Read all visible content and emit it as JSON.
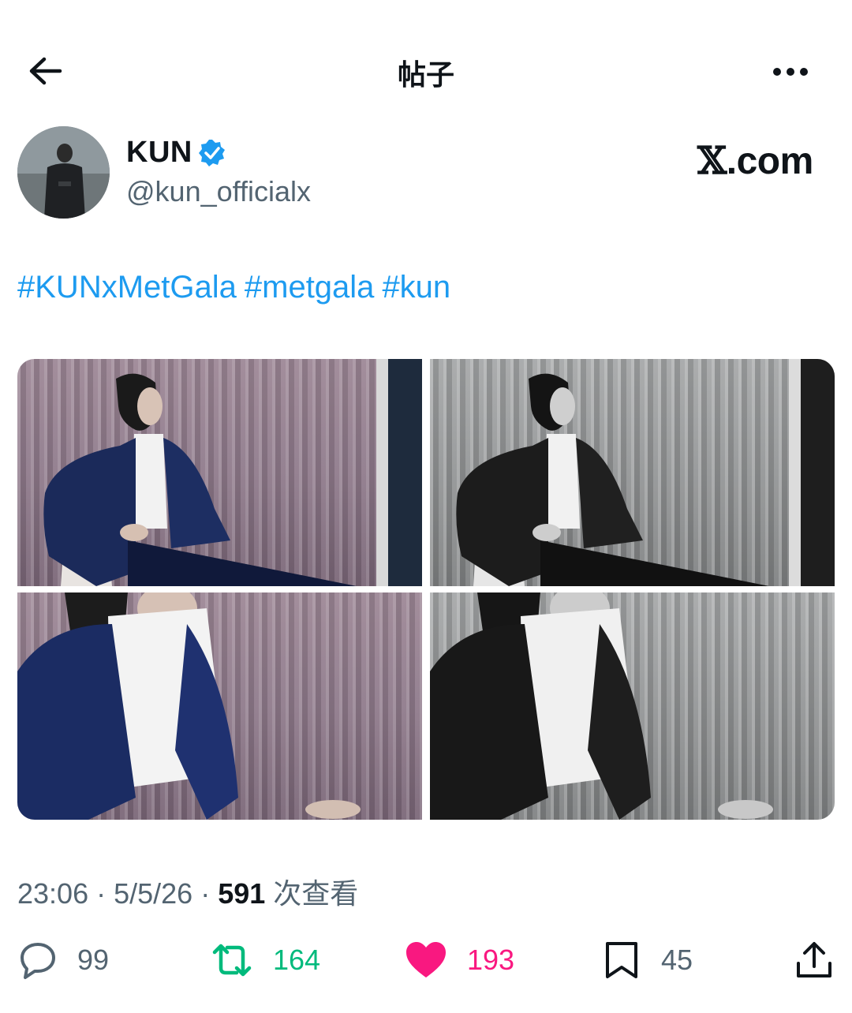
{
  "header": {
    "title": "帖子"
  },
  "author": {
    "name": "KUN",
    "handle": "@kun_officialx"
  },
  "source": {
    "mark": "𝕏",
    "domain": ".com"
  },
  "post": {
    "hashtags": [
      "#KUNxMetGala",
      "#metgala",
      "#kun"
    ]
  },
  "meta": {
    "time": "23:06",
    "sep1": " · ",
    "date": "5/5/26",
    "sep2": " · ",
    "views": "591",
    "views_label": " 次查看"
  },
  "actions": {
    "reply": "99",
    "repost": "164",
    "like": "193",
    "bookmark": "45"
  },
  "colors": {
    "link": "#1d9bf0",
    "repost": "#00ba7c",
    "like": "#f91880",
    "muted": "#536471"
  },
  "icons": [
    "back-arrow-icon",
    "more-icon",
    "verified-icon",
    "reply-icon",
    "repost-icon",
    "heart-icon",
    "bookmark-icon",
    "share-icon"
  ]
}
